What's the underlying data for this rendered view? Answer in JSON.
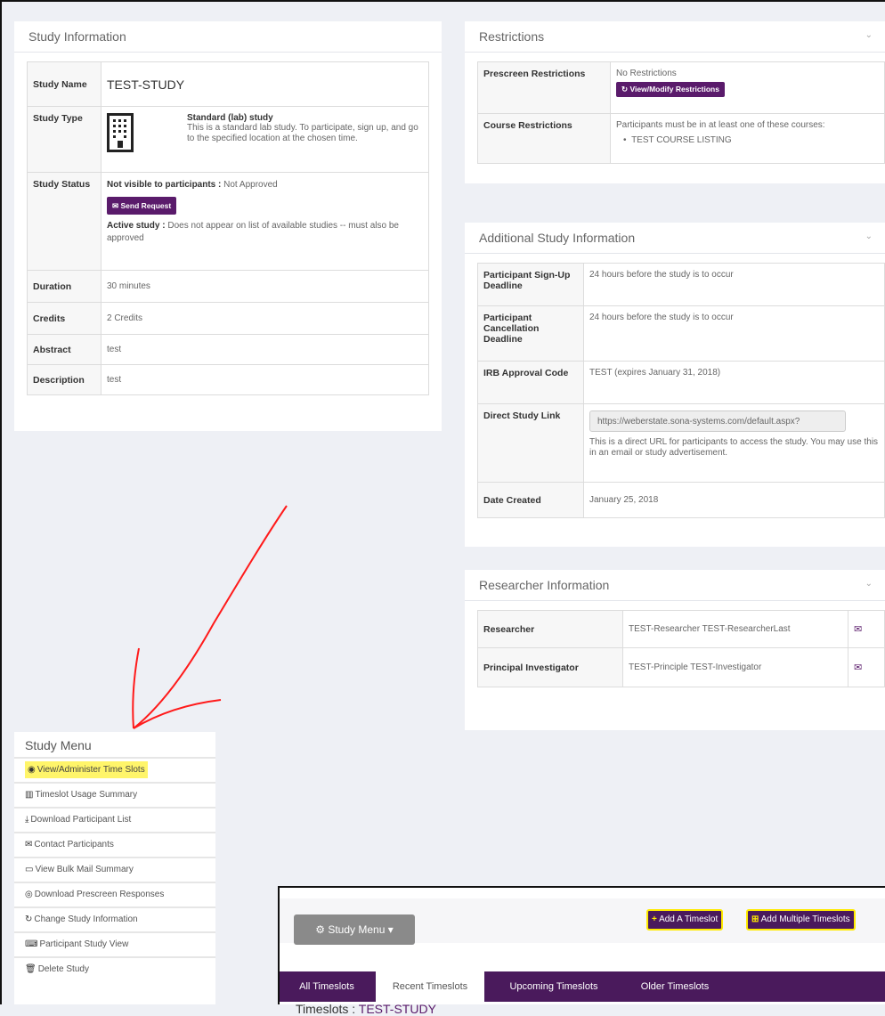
{
  "study_info": {
    "title": "Study Information",
    "rows": {
      "name_key": "Study Name",
      "name_val": "TEST-STUDY",
      "type_key": "Study Type",
      "type_title": "Standard (lab) study",
      "type_desc": "This is a standard lab study. To participate, sign up, and go to the specified location at the chosen time.",
      "status_key": "Study Status",
      "visible_label": "Not visible to participants :",
      "visible_val": "Not Approved",
      "send_request": "Send Request",
      "active_label": "Active study :",
      "active_val": "Does not appear on list of available studies -- must also be approved",
      "duration_key": "Duration",
      "duration_val": "30 minutes",
      "credits_key": "Credits",
      "credits_val": "2 Credits",
      "abstract_key": "Abstract",
      "abstract_val": "test",
      "description_key": "Description",
      "description_val": "test"
    }
  },
  "restrictions": {
    "title": "Restrictions",
    "prescreen_key": "Prescreen Restrictions",
    "prescreen_val": "No Restrictions",
    "modify_btn": "View/Modify Restrictions",
    "course_key": "Course Restrictions",
    "course_val": "Participants must be in at least one of these courses:",
    "course_item": "TEST COURSE LISTING"
  },
  "additional": {
    "title": "Additional Study Information",
    "signup_key": "Participant Sign-Up Deadline",
    "signup_val": "24 hours before the study is to occur",
    "cancel_key": "Participant Cancellation Deadline",
    "cancel_val": "24 hours before the study is to occur",
    "irb_key": "IRB Approval Code",
    "irb_val": "TEST (expires January 31, 2018)",
    "link_key": "Direct Study Link",
    "link_val": "https://weberstate.sona-systems.com/default.aspx?",
    "link_desc": "This is a direct URL for participants to access the study. You may use this in an email or study advertisement.",
    "created_key": "Date Created",
    "created_val": "January 25, 2018"
  },
  "researcher": {
    "title": "Researcher Information",
    "researcher_key": "Researcher",
    "researcher_val": "TEST-Researcher TEST-ResearcherLast",
    "pi_key": "Principal Investigator",
    "pi_val": "TEST-Principle TEST-Investigator"
  },
  "study_menu": {
    "title": "Study Menu",
    "items": [
      {
        "label": "View/Administer Time Slots",
        "icon": "eye-icon"
      },
      {
        "label": "Timeslot Usage Summary",
        "icon": "chart-icon"
      },
      {
        "label": "Download Participant List",
        "icon": "download-icon"
      },
      {
        "label": "Contact Participants",
        "icon": "envelope-icon"
      },
      {
        "label": "View Bulk Mail Summary",
        "icon": "inbox-icon"
      },
      {
        "label": "Download Prescreen Responses",
        "icon": "record-icon"
      },
      {
        "label": "Change Study Information",
        "icon": "refresh-icon"
      },
      {
        "label": "Participant Study View",
        "icon": "laptop-icon"
      },
      {
        "label": "Delete Study",
        "icon": "trash-icon"
      }
    ]
  },
  "timeslots": {
    "study_menu_btn": "Study Menu",
    "add_one": "Add A Timeslot",
    "add_multiple": "Add Multiple Timeslots",
    "tabs": [
      "All Timeslots",
      "Recent Timeslots",
      "Upcoming Timeslots",
      "Older Timeslots"
    ],
    "heading_prefix": "Timeslots :",
    "heading_study": "TEST-STUDY"
  },
  "annotation_color": "#ff1a1a",
  "highlight_color": "#fff56a"
}
